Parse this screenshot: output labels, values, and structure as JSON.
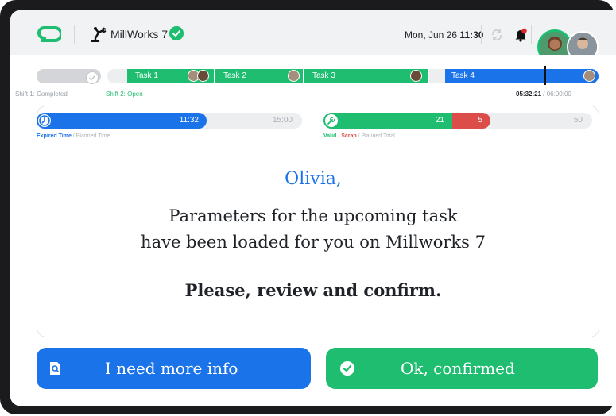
{
  "header": {
    "machine_name": "MillWorks 7",
    "date": "Mon, Jun 26",
    "time": "11:30"
  },
  "timeline": {
    "shift1_label": "Shift 1: Completed",
    "shift2_label": "Shift 2: Open",
    "tasks": [
      {
        "label": "Task 1"
      },
      {
        "label": "Task 2"
      },
      {
        "label": "Task 3"
      },
      {
        "label": "Task 4"
      }
    ],
    "elapsed": "05:32:21",
    "planned": "/ 06:00:00"
  },
  "progress": {
    "expired_value": "11:32",
    "planned_value": "15:00",
    "expired_fraction": 0.64,
    "valid_value": "21",
    "scrap_value": "5",
    "planned_total": "50",
    "legend_left": {
      "expired": "Expired Time",
      "rest": "/ Planned Time"
    },
    "legend_right": {
      "valid": "Valid",
      "scrap": "Scrap",
      "rest": "/ Planned Total"
    }
  },
  "message": {
    "greeting": "Olivia,",
    "line1": "Parameters for the upcoming task",
    "line2": "have been loaded for you on Millworks 7",
    "prompt": "Please, review and confirm."
  },
  "actions": {
    "info_label": "I need more info",
    "confirm_label": "Ok, confirmed"
  },
  "colors": {
    "accent_blue": "#1a73e8",
    "accent_green": "#1fbd70",
    "scrap_red": "#dc4d4a"
  },
  "icons": {
    "logo": "app-logo-icon",
    "machine": "robot-arm-icon",
    "status": "check-circle-icon",
    "sync": "sync-icon",
    "notifications": "bell-icon",
    "timer": "timer-icon",
    "wrench": "wrench-icon",
    "info": "search-document-icon",
    "confirm": "check-circle-icon"
  }
}
